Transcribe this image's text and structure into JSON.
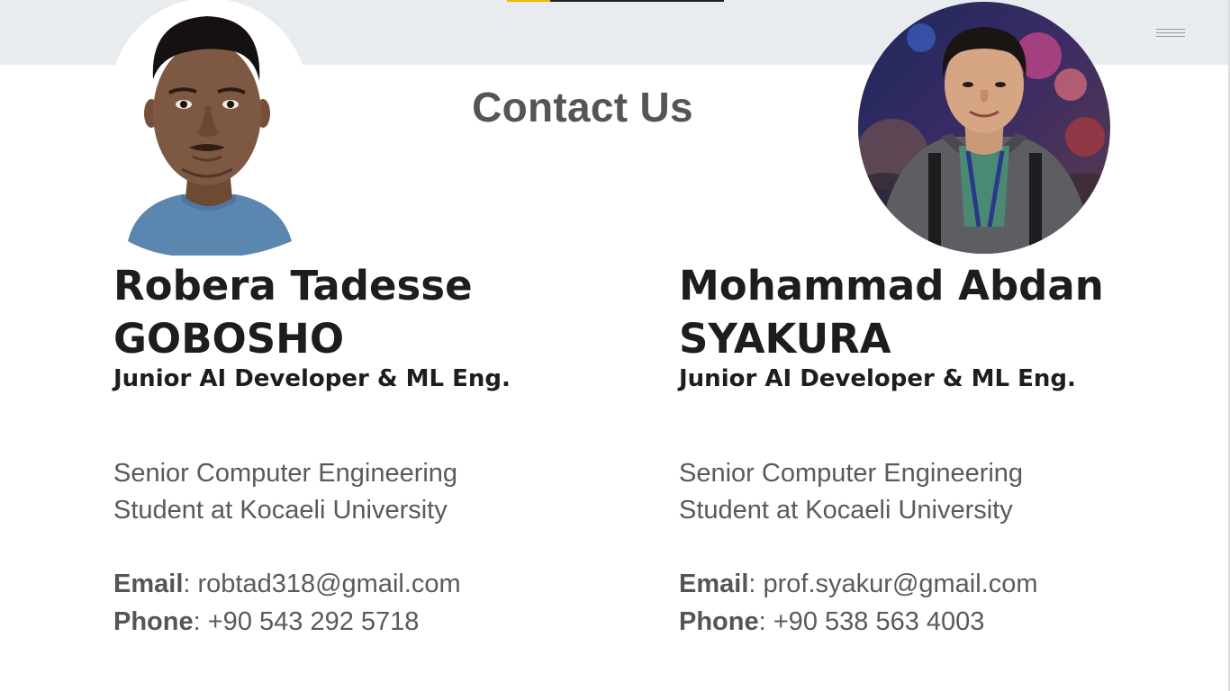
{
  "header": {
    "progress_fraction": 0.2,
    "menu_icon": "hamburger-menu-icon"
  },
  "page": {
    "title": "Contact Us"
  },
  "people": [
    {
      "name_line1": "Robera Tadesse",
      "name_line2": "GOBOSHO",
      "role": "Junior AI Developer & ML Eng.",
      "desc_line1": "Senior Computer Engineering",
      "desc_line2": "Student at Kocaeli University",
      "email_label": "Email",
      "email": "robtad318@gmail.com",
      "phone_label": "Phone",
      "phone": "+90 543 292 5718"
    },
    {
      "name_line1": "Mohammad Abdan",
      "name_line2": "SYAKURA",
      "role": "Junior AI Developer & ML Eng.",
      "desc_line1": "Senior Computer Engineering",
      "desc_line2": "Student at Kocaeli University",
      "email_label": "Email",
      "email": "prof.syakur@gmail.com",
      "phone_label": "Phone",
      "phone": "+90 538 563 4003"
    }
  ],
  "colors": {
    "header_bg": "#e9ecee",
    "progress_accent": "#f5b400",
    "heading_text": "#1d1d1d",
    "body_text": "#5a5a5a"
  }
}
